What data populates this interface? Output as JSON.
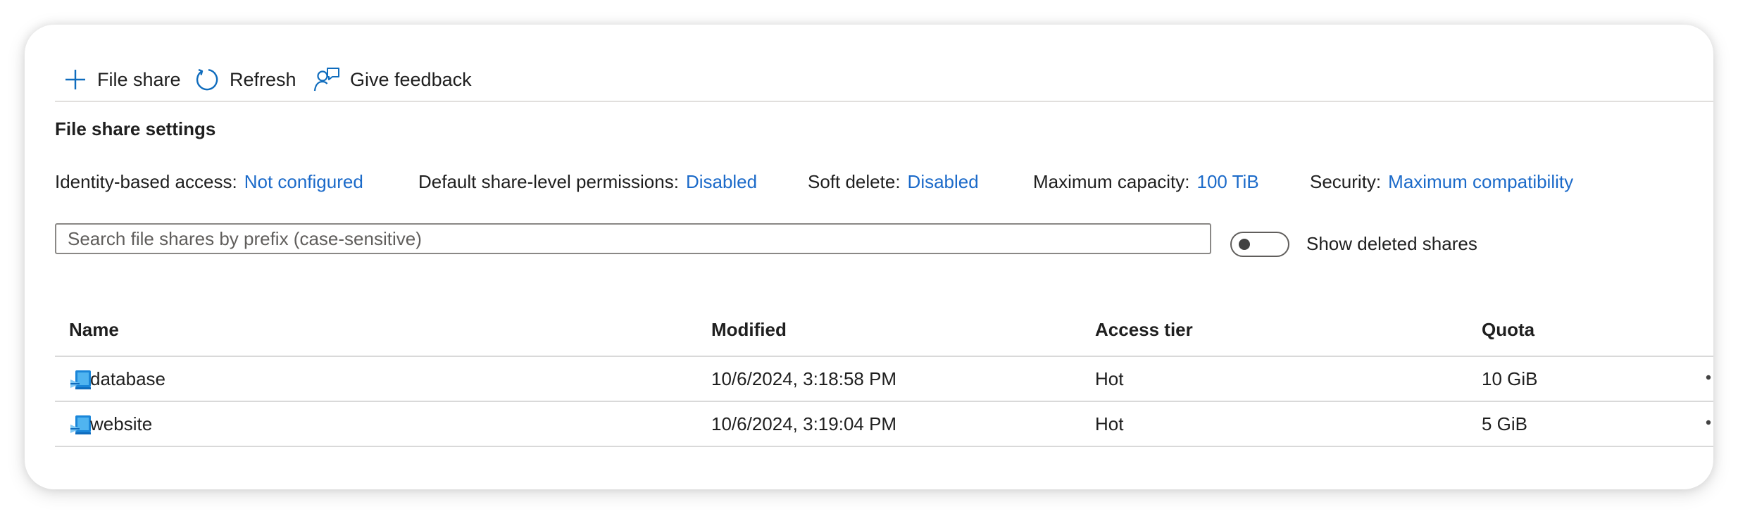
{
  "toolbar": {
    "add_file_share_label": "File share",
    "refresh_label": "Refresh",
    "feedback_label": "Give feedback"
  },
  "settings": {
    "title": "File share settings",
    "identity_key": "Identity-based access:",
    "identity_value": "Not configured",
    "permissions_key": "Default share-level permissions:",
    "permissions_value": "Disabled",
    "soft_delete_key": "Soft delete:",
    "soft_delete_value": "Disabled",
    "capacity_key": "Maximum capacity:",
    "capacity_value": "100 TiB",
    "security_key": "Security:",
    "security_value": "Maximum compatibility"
  },
  "search": {
    "placeholder": "Search file shares by prefix (case-sensitive)",
    "value": ""
  },
  "show_deleted": {
    "label": "Show deleted shares",
    "enabled": false
  },
  "table": {
    "columns": {
      "name": "Name",
      "modified": "Modified",
      "tier": "Access tier",
      "quota": "Quota"
    },
    "rows": [
      {
        "name": "database",
        "modified": "10/6/2024, 3:18:58 PM",
        "tier": "Hot",
        "quota": "10 GiB"
      },
      {
        "name": "website",
        "modified": "10/6/2024, 3:19:04 PM",
        "tier": "Hot",
        "quota": "5 GiB"
      }
    ]
  },
  "colors": {
    "link": "#1b6ac9",
    "icon_accent": "#0f6cbd",
    "text": "#1f1f1f"
  },
  "icons": {
    "add": "plus-icon",
    "refresh": "refresh-icon",
    "feedback": "feedback-icon",
    "share": "file-share-icon",
    "more": "more-icon"
  }
}
